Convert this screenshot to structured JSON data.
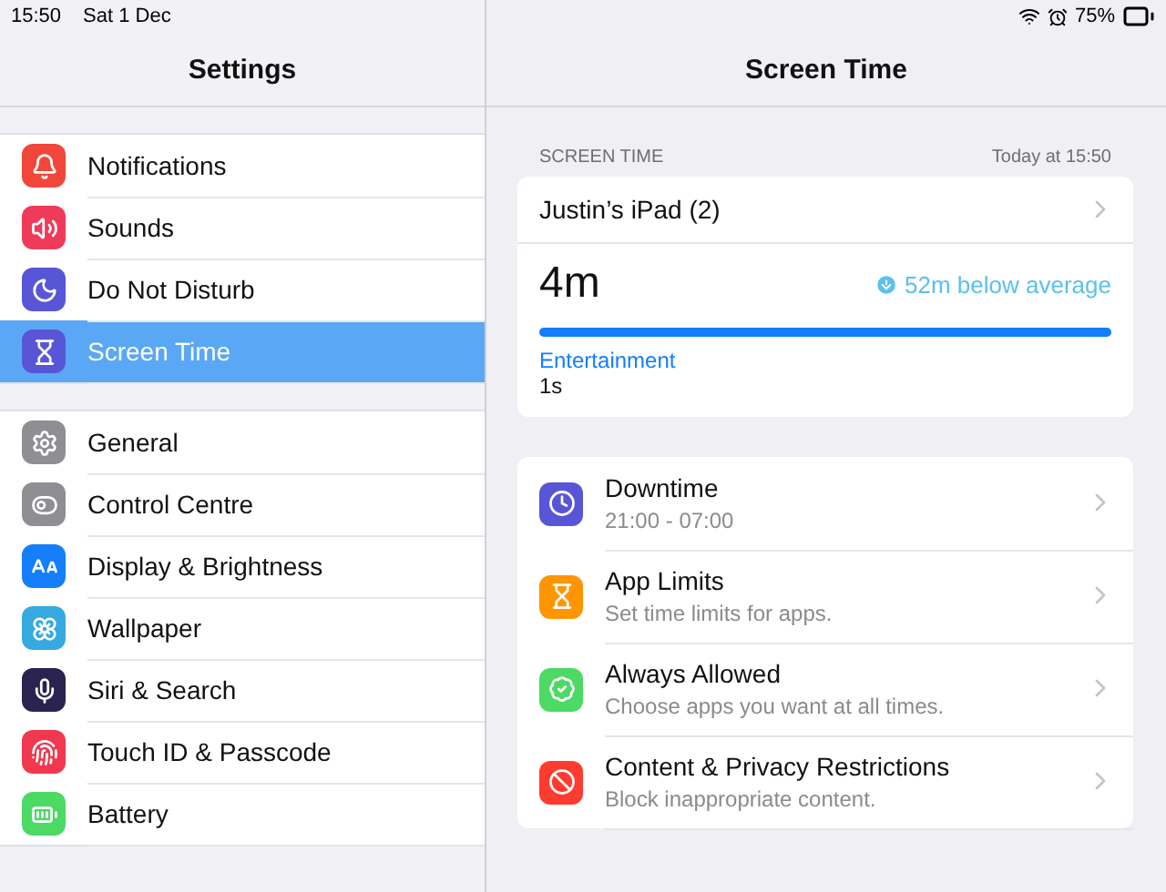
{
  "status_bar": {
    "time": "15:50",
    "date": "Sat 1 Dec",
    "battery": "75%"
  },
  "sidebar": {
    "title": "Settings",
    "groups": [
      [
        {
          "label": "Notifications",
          "kind": "notifications",
          "color": "#f0473a",
          "selected": false
        },
        {
          "label": "Sounds",
          "kind": "sounds",
          "color": "#f03a5a",
          "selected": false
        },
        {
          "label": "Do Not Disturb",
          "kind": "moon",
          "color": "#5856d6",
          "selected": false
        },
        {
          "label": "Screen Time",
          "kind": "hourglass",
          "color": "#5856d6",
          "selected": true
        }
      ],
      [
        {
          "label": "General",
          "kind": "gear",
          "color": "#8e8e93",
          "selected": false
        },
        {
          "label": "Control Centre",
          "kind": "toggles",
          "color": "#8e8e93",
          "selected": false
        },
        {
          "label": "Display & Brightness",
          "kind": "text",
          "color": "#147efb",
          "selected": false
        },
        {
          "label": "Wallpaper",
          "kind": "flower",
          "color": "#36a9e0",
          "selected": false
        },
        {
          "label": "Siri & Search",
          "kind": "siri",
          "color": "#2a2350",
          "selected": false
        },
        {
          "label": "Touch ID & Passcode",
          "kind": "fingerprint",
          "color": "#f0384f",
          "selected": false
        },
        {
          "label": "Battery",
          "kind": "battery",
          "color": "#4cd964",
          "selected": false
        }
      ]
    ]
  },
  "detail": {
    "title": "Screen Time",
    "section_header": "SCREEN TIME",
    "section_time": "Today at 15:50",
    "device": "Justin’s iPad (2)",
    "usage": "4m",
    "comparison": "52m below average",
    "level": 1,
    "category": "Entertainment",
    "category_time": "1s",
    "options": [
      {
        "title": "Downtime",
        "subtitle": "21:00 - 07:00",
        "kind": "downtime",
        "color": "#5856d6"
      },
      {
        "title": "App Limits",
        "subtitle": "Set time limits for apps.",
        "kind": "hourglass",
        "color": "#ff9500"
      },
      {
        "title": "Always Allowed",
        "subtitle": "Choose apps you want at all times.",
        "kind": "check",
        "color": "#4cd964"
      },
      {
        "title": "Content & Privacy Restrictions",
        "subtitle": "Block inappropriate content.",
        "kind": "block",
        "color": "#ff3b30"
      }
    ]
  }
}
